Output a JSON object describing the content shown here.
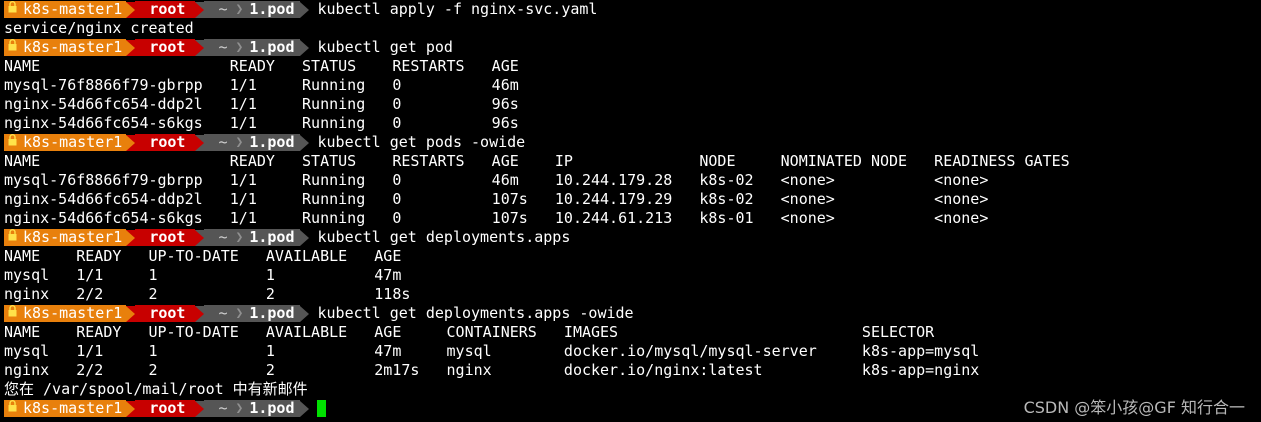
{
  "prompt": {
    "lock_icon": "lock-icon",
    "host": "k8s-master1",
    "user": "root",
    "tilde": "~",
    "dir": "1.pod"
  },
  "colors": {
    "host_bg": "#e8800c",
    "user_bg": "#c80000",
    "dir_bg": "#555555",
    "cursor": "#00e000"
  },
  "lines": [
    {
      "type": "prompt",
      "cmd": "kubectl apply -f nginx-svc.yaml"
    },
    {
      "type": "out",
      "text": "service/nginx created"
    },
    {
      "type": "prompt",
      "cmd": "kubectl get pod"
    },
    {
      "type": "out",
      "text": "NAME                     READY   STATUS    RESTARTS   AGE"
    },
    {
      "type": "out",
      "text": "mysql-76f8866f79-gbrpp   1/1     Running   0          46m"
    },
    {
      "type": "out",
      "text": "nginx-54d66fc654-ddp2l   1/1     Running   0          96s"
    },
    {
      "type": "out",
      "text": "nginx-54d66fc654-s6kgs   1/1     Running   0          96s"
    },
    {
      "type": "prompt",
      "cmd": "kubectl get pods -owide"
    },
    {
      "type": "out",
      "text": "NAME                     READY   STATUS    RESTARTS   AGE    IP              NODE     NOMINATED NODE   READINESS GATES"
    },
    {
      "type": "out",
      "text": "mysql-76f8866f79-gbrpp   1/1     Running   0          46m    10.244.179.28   k8s-02   <none>           <none>"
    },
    {
      "type": "out",
      "text": "nginx-54d66fc654-ddp2l   1/1     Running   0          107s   10.244.179.29   k8s-02   <none>           <none>"
    },
    {
      "type": "out",
      "text": "nginx-54d66fc654-s6kgs   1/1     Running   0          107s   10.244.61.213   k8s-01   <none>           <none>"
    },
    {
      "type": "prompt",
      "cmd": "kubectl get deployments.apps"
    },
    {
      "type": "out",
      "text": "NAME    READY   UP-TO-DATE   AVAILABLE   AGE"
    },
    {
      "type": "out",
      "text": "mysql   1/1     1            1           47m"
    },
    {
      "type": "out",
      "text": "nginx   2/2     2            2           118s"
    },
    {
      "type": "prompt",
      "cmd": "kubectl get deployments.apps -owide"
    },
    {
      "type": "out",
      "text": "NAME    READY   UP-TO-DATE   AVAILABLE   AGE     CONTAINERS   IMAGES                           SELECTOR"
    },
    {
      "type": "out",
      "text": "mysql   1/1     1            1           47m     mysql        docker.io/mysql/mysql-server     k8s-app=mysql"
    },
    {
      "type": "out",
      "text": "nginx   2/2     2            2           2m17s   nginx        docker.io/nginx:latest           k8s-app=nginx"
    },
    {
      "type": "out",
      "text": "您在 /var/spool/mail/root 中有新邮件"
    },
    {
      "type": "prompt",
      "cmd": "",
      "cursor": true
    }
  ],
  "watermark": "CSDN @笨小孩@GF 知行合一"
}
